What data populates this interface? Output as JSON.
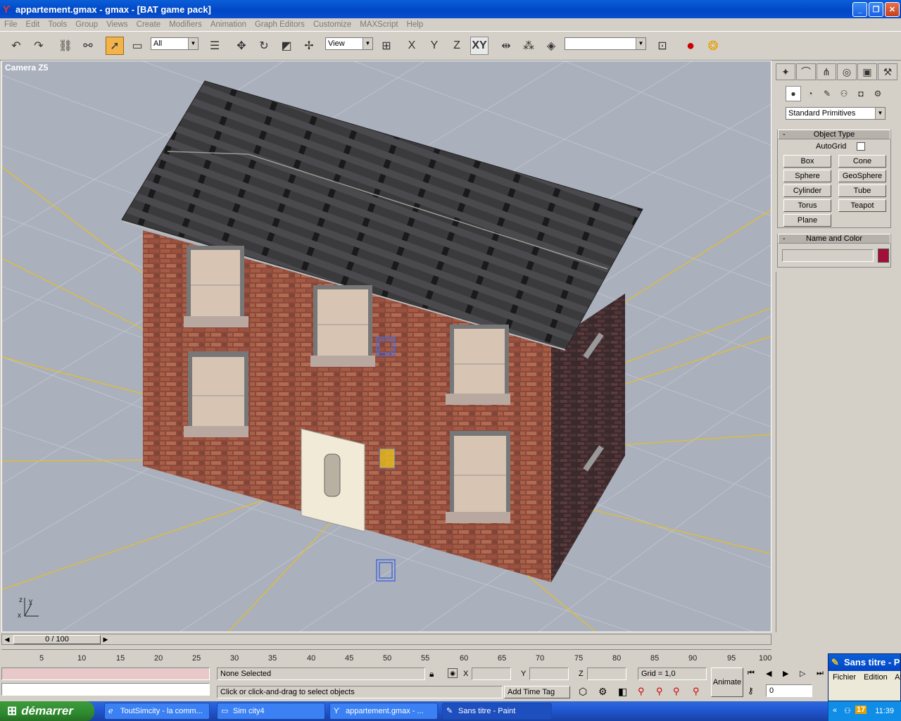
{
  "window": {
    "title": "appartement.gmax - gmax - [BAT game pack]"
  },
  "menu": [
    "File",
    "Edit",
    "Tools",
    "Group",
    "Views",
    "Create",
    "Modifiers",
    "Animation",
    "Graph Editors",
    "Customize",
    "MAXScript",
    "Help"
  ],
  "toolbar": {
    "filter_value": "All",
    "coord_value": "View",
    "axis_x": "X",
    "axis_y": "Y",
    "axis_z": "Z",
    "axis_xy": "XY",
    "named_selection": ""
  },
  "viewport": {
    "label": "Camera Z5"
  },
  "command_panel": {
    "category": "Standard Primitives",
    "object_type_title": "Object Type",
    "autogrid_label": "AutoGrid",
    "buttons": [
      "Box",
      "Cone",
      "Sphere",
      "GeoSphere",
      "Cylinder",
      "Tube",
      "Torus",
      "Teapot",
      "Plane"
    ],
    "name_color_title": "Name and Color",
    "name_value": "",
    "color": "#a0103a"
  },
  "timeline": {
    "slider_text": "0 / 100",
    "ticks": [
      "5",
      "10",
      "15",
      "20",
      "25",
      "30",
      "35",
      "40",
      "45",
      "50",
      "55",
      "60",
      "65",
      "70",
      "75",
      "80",
      "85",
      "90",
      "95",
      "100"
    ]
  },
  "status": {
    "selection": "None Selected",
    "prompt": "Click or click-and-drag to select objects",
    "x_label": "X",
    "y_label": "Y",
    "z_label": "Z",
    "grid": "Grid = 1,0",
    "add_time_tag": "Add Time Tag",
    "animate": "Animate",
    "frame": "0"
  },
  "taskbar": {
    "start": "démarrer",
    "tasks": [
      "ToutSimcity - la comm...",
      "Sim city4",
      "appartement.gmax - ...",
      "Sans titre - Paint"
    ],
    "tray_badge": "17",
    "clock": "11:39"
  },
  "paint": {
    "title": "Sans titre - P",
    "menu": [
      "Fichier",
      "Edition",
      "Af"
    ]
  }
}
